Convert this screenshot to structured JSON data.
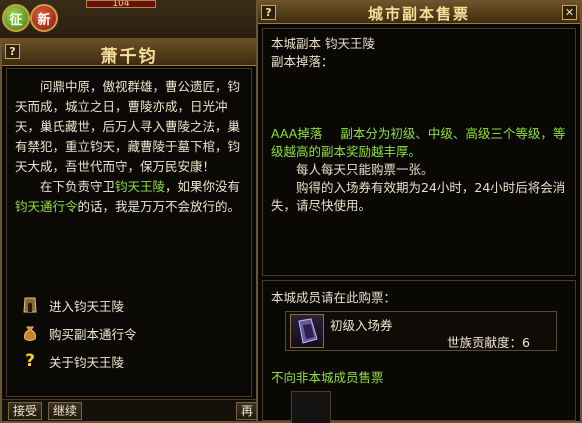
{
  "hud": {
    "orb_left": "征",
    "orb_right": "新",
    "top_value": "104"
  },
  "npc": {
    "title": "萧千钧",
    "help_button": "?",
    "paragraph1": "问鼎中原，傲视群雄，曹公遗匠，钧天而成，城立之日，曹陵亦成，日光冲天，巢氏藏世，后万人寻入曹陵之法，巢有禁犯，重立钧天，藏曹陵于墓下棺，钧天大成，吾世代而守，保万民安康！",
    "p2_a": "在下负责守卫",
    "p2_hl1": "钧天王陵",
    "p2_b": "，如果你没有",
    "p2_hl2": "钧天通行令",
    "p2_c": "的话，我是万万不会放行的。",
    "options": [
      {
        "label": "进入钧天王陵",
        "icon": "gate-icon"
      },
      {
        "label": "购买副本通行令",
        "icon": "money-bag-icon"
      },
      {
        "label": "关于钧天王陵",
        "icon": "question-icon"
      }
    ],
    "footer": {
      "accept": "接受",
      "continue": "继续",
      "right_btn": "再"
    }
  },
  "shop": {
    "title": "城市副本售票",
    "help_button": "?",
    "close_button": "✕",
    "dungeon_line": "本城副本 钧天王陵",
    "drop_label": "副本掉落：",
    "aaa_prefix": "AAA掉落",
    "aaa_text": "副本分为初级、中级、高级三个等级，等级越高的副本奖励越丰厚。",
    "daily_limit": "每人每天只能购票一张。",
    "validity": "购得的入场券有效期为24小时，24小时后将会消失，请尽快使用。",
    "member_header": "本城成员请在此购票：",
    "ticket": {
      "name": "初级入场券",
      "cost": "世族贡献度：6"
    },
    "non_member": "不向非本城成员售票"
  },
  "colors": {
    "highlight_green": "#8fe03a",
    "title_gold": "#f6df9a",
    "border_brown": "#6b5431"
  }
}
